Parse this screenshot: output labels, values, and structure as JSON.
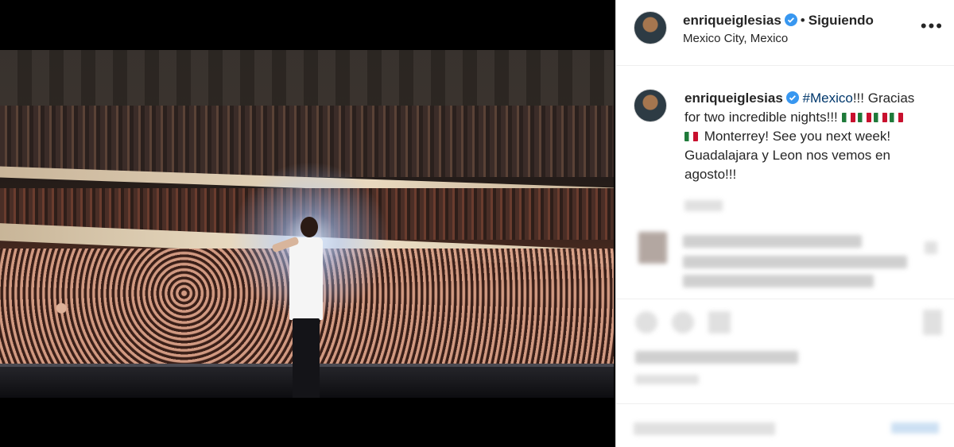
{
  "post": {
    "author": {
      "username": "enriqueiglesias",
      "verified": true,
      "follow_status": "Siguiendo",
      "location": "Mexico City, Mexico"
    },
    "caption": {
      "username": "enriqueiglesias",
      "hashtag": "#Mexico",
      "line1": "!!! Gracias for two incredible nights!!!",
      "line2": "Monterrey! See you next week! Guadalajara y Leon nos vemos en agosto!!!"
    },
    "more_icon": "more-horizontal-icon",
    "colors": {
      "text": "#262626",
      "hashtag": "#00376b",
      "verified": "#3897f0",
      "border": "#dbdbdb"
    }
  }
}
